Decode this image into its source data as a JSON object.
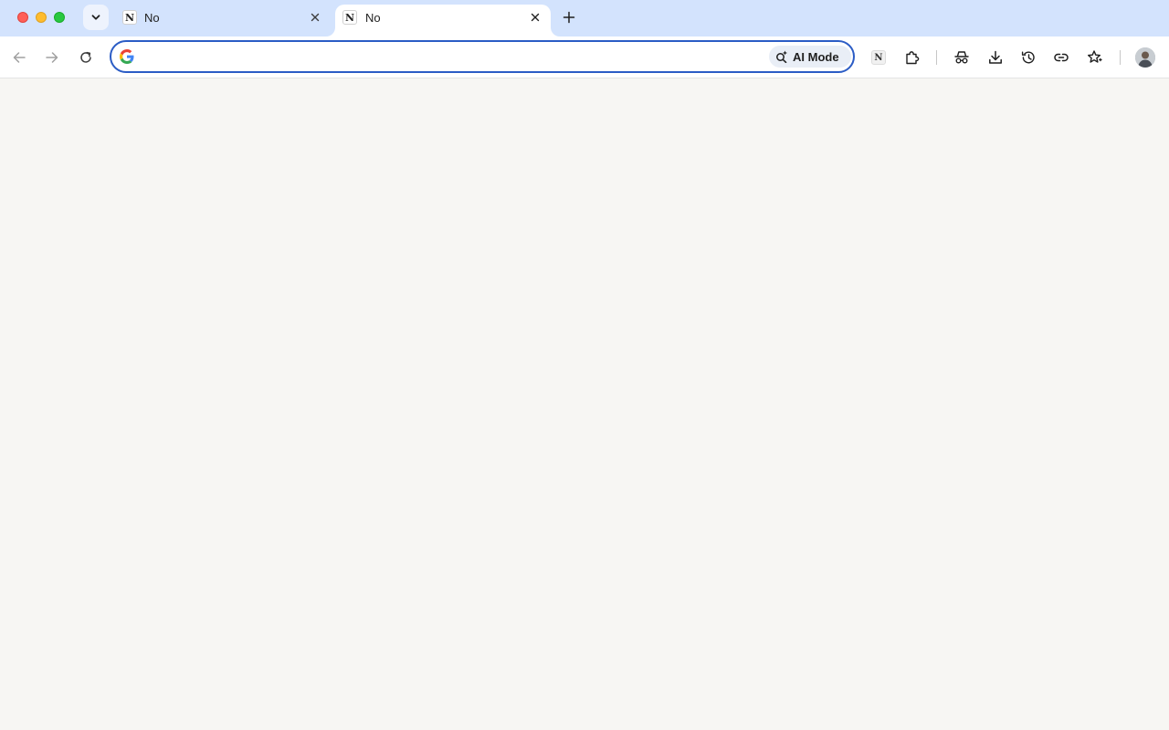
{
  "window": {
    "traffic_lights": {
      "close": "#ff5f57",
      "minimize": "#febc2e",
      "maximize": "#28c840"
    }
  },
  "tabs": [
    {
      "favicon_text": "N",
      "title": "No",
      "active": false
    },
    {
      "favicon_text": "N",
      "title": "No",
      "active": true
    }
  ],
  "tab_controls": {
    "search_icon": "chevron-down-icon",
    "new_tab_icon": "plus-icon",
    "close_icon": "close-icon"
  },
  "toolbar": {
    "back_icon": "arrow-left-icon",
    "forward_icon": "arrow-right-icon",
    "reload_icon": "reload-icon",
    "omnibox": {
      "value": "",
      "placeholder": "",
      "engine_icon": "google-g-icon",
      "focus_color": "#2b5cc5"
    },
    "ai_mode": {
      "label": "AI Mode",
      "icon": "sparkle-search-icon"
    },
    "extension_favicon_text": "N",
    "action_icons": [
      "puzzle-extensions-icon",
      "incognito-icon",
      "download-icon",
      "history-icon",
      "link-icon",
      "bookmarks-star-icon"
    ],
    "profile_icon": "avatar"
  },
  "colors": {
    "tabstrip_bg": "#d3e3fd",
    "toolbar_bg": "#ffffff",
    "content_bg": "#f7f6f3"
  }
}
